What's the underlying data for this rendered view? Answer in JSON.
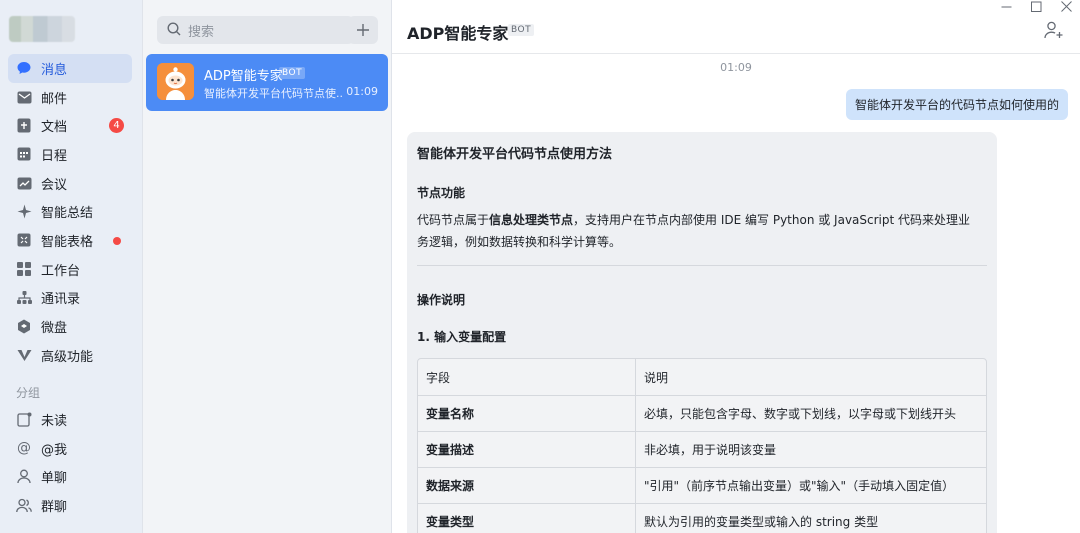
{
  "nav": {
    "items": [
      {
        "label": "消息",
        "icon": "chat-bubble-icon",
        "active": true
      },
      {
        "label": "邮件",
        "icon": "mail-icon"
      },
      {
        "label": "文档",
        "icon": "doc-icon",
        "badge": "4"
      },
      {
        "label": "日程",
        "icon": "calendar-icon"
      },
      {
        "label": "会议",
        "icon": "meeting-icon"
      },
      {
        "label": "智能总结",
        "icon": "sparkle-icon"
      },
      {
        "label": "智能表格",
        "icon": "sheet-icon",
        "dot": true
      },
      {
        "label": "工作台",
        "icon": "grid-icon"
      },
      {
        "label": "通讯录",
        "icon": "contacts-icon"
      },
      {
        "label": "微盘",
        "icon": "drive-icon"
      },
      {
        "label": "高级功能",
        "icon": "premium-icon"
      }
    ],
    "group_title": "分组",
    "group_items": [
      {
        "label": "未读",
        "icon": "unread-icon"
      },
      {
        "label": "@我",
        "icon": "at-icon"
      },
      {
        "label": "单聊",
        "icon": "person-icon"
      },
      {
        "label": "群聊",
        "icon": "group-icon"
      }
    ]
  },
  "conversations": {
    "search_placeholder": "搜索",
    "items": [
      {
        "name": "ADP智能专家",
        "tag": "BOT",
        "preview": "智能体开发平台代码节点使...",
        "time": "01:09"
      }
    ]
  },
  "chat": {
    "title": "ADP智能专家",
    "tag": "BOT",
    "time_separator": "01:09",
    "user_message": "智能体开发平台的代码节点如何使用的",
    "reply": {
      "title": "智能体开发平台代码节点使用方法",
      "section1_title": "节点功能",
      "section1_prefix": "代码节点属于",
      "section1_bold": "信息处理类节点",
      "section1_suffix": "，支持用户在节点内部使用 IDE 编写 Python 或 JavaScript 代码来处理业务逻辑，例如数据转换和科学计算等。",
      "section2_title": "操作说明",
      "section2_sub": "1. 输入变量配置",
      "table": {
        "header": [
          "字段",
          "说明"
        ],
        "rows": [
          [
            "变量名称",
            "必填，只能包含字母、数字或下划线，以字母或下划线开头"
          ],
          [
            "变量描述",
            "非必填，用于说明该变量"
          ],
          [
            "数据来源",
            "\"引用\"（前序节点输出变量）或\"输入\"（手动填入固定值）"
          ],
          [
            "变量类型",
            "默认为引用的变量类型或输入的 string 类型"
          ]
        ]
      }
    }
  },
  "colors": {
    "accent": "#3370ff",
    "selected_conv": "#4c8bf5",
    "user_bubble": "#cfe3fb",
    "badge": "#f54a45"
  }
}
